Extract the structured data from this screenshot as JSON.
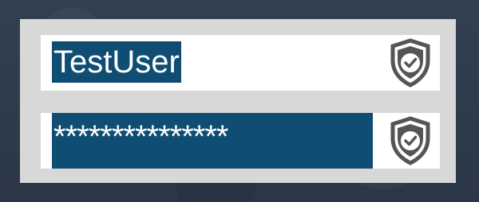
{
  "username_field": {
    "value": "TestUser",
    "icon": "shield-check-icon"
  },
  "password_field": {
    "value": "***************",
    "icon": "shield-check-icon"
  },
  "colors": {
    "background": "#2f3b4b",
    "panel": "#d8d8d8",
    "field_background": "#ffffff",
    "selection": "#0f4d73",
    "selection_text": "#ffffff",
    "icon": "#555555"
  }
}
